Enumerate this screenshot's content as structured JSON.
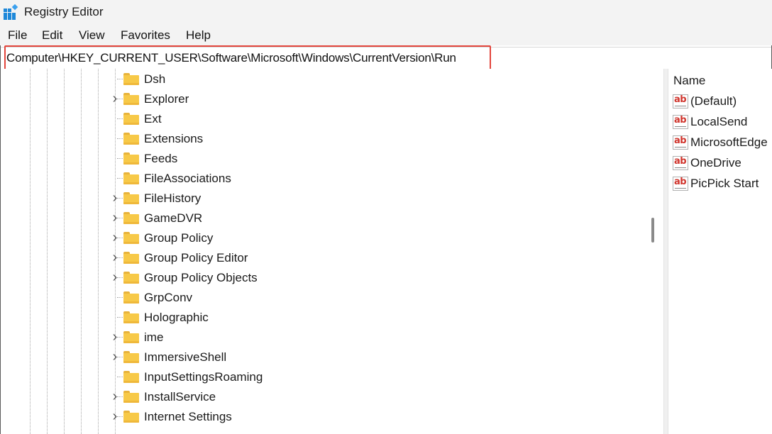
{
  "window": {
    "title": "Registry Editor"
  },
  "menu": {
    "items": [
      "File",
      "Edit",
      "View",
      "Favorites",
      "Help"
    ]
  },
  "address": {
    "path": "Computer\\HKEY_CURRENT_USER\\Software\\Microsoft\\Windows\\CurrentVersion\\Run"
  },
  "tree": {
    "items": [
      {
        "label": "Dsh",
        "expandable": false
      },
      {
        "label": "Explorer",
        "expandable": true
      },
      {
        "label": "Ext",
        "expandable": false
      },
      {
        "label": "Extensions",
        "expandable": false
      },
      {
        "label": "Feeds",
        "expandable": false
      },
      {
        "label": "FileAssociations",
        "expandable": false
      },
      {
        "label": "FileHistory",
        "expandable": true
      },
      {
        "label": "GameDVR",
        "expandable": true
      },
      {
        "label": "Group Policy",
        "expandable": true
      },
      {
        "label": "Group Policy Editor",
        "expandable": true
      },
      {
        "label": "Group Policy Objects",
        "expandable": true
      },
      {
        "label": "GrpConv",
        "expandable": false
      },
      {
        "label": "Holographic",
        "expandable": false
      },
      {
        "label": "ime",
        "expandable": true
      },
      {
        "label": "ImmersiveShell",
        "expandable": true
      },
      {
        "label": "InputSettingsRoaming",
        "expandable": false
      },
      {
        "label": "InstallService",
        "expandable": true
      },
      {
        "label": "Internet Settings",
        "expandable": true
      }
    ]
  },
  "values_pane": {
    "header": "Name",
    "items": [
      "(Default)",
      "LocalSend",
      "MicrosoftEdge",
      "OneDrive",
      "PicPick Start"
    ]
  },
  "colors": {
    "highlight": "#e2453c",
    "folder": "#f7c948",
    "ab_icon": "#d0342c"
  }
}
